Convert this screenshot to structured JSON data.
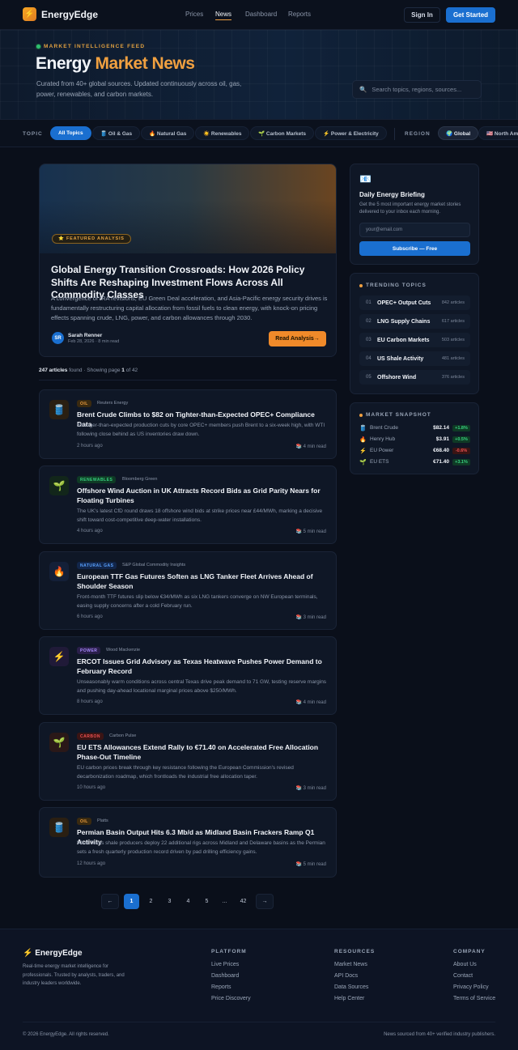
{
  "nav": {
    "brand": "EnergyEdge",
    "links": [
      "Prices",
      "News",
      "Dashboard",
      "Reports"
    ],
    "active_link": "News",
    "sign_in": "Sign In",
    "get_started": "Get Started"
  },
  "hero": {
    "eyebrow": "MARKET INTELLIGENCE FEED",
    "title_a": "Energy ",
    "title_b": "Market News",
    "subtitle": "Curated from 40+ global sources. Updated continuously across oil, gas, power, renewables, and carbon markets.",
    "search_placeholder": "Search topics, regions, sources..."
  },
  "filters": {
    "topic_label": "TOPIC",
    "topics": [
      "All Topics",
      "🛢️ Oil & Gas",
      "🔥 Natural Gas",
      "☀️ Renewables",
      "🌱 Carbon Markets",
      "⚡ Power & Electricity"
    ],
    "region_label": "REGION",
    "regions": [
      "🌍 Global",
      "🇺🇸 North America"
    ]
  },
  "featured": {
    "badge": "⭐ FEATURED ANALYSIS",
    "title": "Global Energy Transition Crossroads: How 2026 Policy Shifts Are Reshaping Investment Flows Across All Commodity Classes",
    "excerpt": "A convergence of IRA revisions, EU Green Deal acceleration, and Asia-Pacific energy security drives is fundamentally restructuring capital allocation from fossil fuels to clean energy, with knock-on pricing effects spanning crude, LNG, power, and carbon allowances through 2030.",
    "author_initials": "SR",
    "author_name": "Sarah Renner",
    "author_meta": "Feb 28, 2026 · 8 min read",
    "cta": "Read Analysis→"
  },
  "results": {
    "count": "247 articles",
    "found": " found · Showing page ",
    "page": "1",
    "of": " of 42"
  },
  "articles": [
    {
      "icon": "🛢️",
      "tag": "OIL",
      "source": "Reuters Energy",
      "title": "Brent Crude Climbs to $82 on Tighter-than-Expected OPEC+ Compliance Data",
      "excerpt": "Stronger-than-expected production cuts by core OPEC+ members push Brent to a six-week high, with WTI following close behind as US inventories draw down.",
      "time": "2 hours ago",
      "read": "📚 4 min read"
    },
    {
      "icon": "🌱",
      "tag": "RENEWABLES",
      "source": "Bloomberg Green",
      "title": "Offshore Wind Auction in UK Attracts Record Bids as Grid Parity Nears for Floating Turbines",
      "excerpt": "The UK's latest CfD round draws 18 offshore wind bids at strike prices near £44/MWh, marking a decisive shift toward cost-competitive deep-water installations.",
      "time": "4 hours ago",
      "read": "📚 5 min read"
    },
    {
      "icon": "🔥",
      "tag": "NATURAL GAS",
      "source": "S&P Global Commodity Insights",
      "title": "European TTF Gas Futures Soften as LNG Tanker Fleet Arrives Ahead of Shoulder Season",
      "excerpt": "Front-month TTF futures slip below €34/MWh as six LNG tankers converge on NW European terminals, easing supply concerns after a cold February run.",
      "time": "6 hours ago",
      "read": "📚 3 min read"
    },
    {
      "icon": "⚡",
      "tag": "POWER",
      "source": "Wood Mackenzie",
      "title": "ERCOT Issues Grid Advisory as Texas Heatwave Pushes Power Demand to February Record",
      "excerpt": "Unseasonably warm conditions across central Texas drive peak demand to 71 GW, testing reserve margins and pushing day-ahead locational marginal prices above $250/MWh.",
      "time": "8 hours ago",
      "read": "📚 4 min read"
    },
    {
      "icon": "🌱",
      "tag": "CARBON",
      "source": "Carbon Pulse",
      "title": "EU ETS Allowances Extend Rally to €71.40 on Accelerated Free Allocation Phase-Out Timeline",
      "excerpt": "EU carbon prices break through key resistance following the European Commission's revised decarbonization roadmap, which frontloads the industrial free allocation taper.",
      "time": "10 hours ago",
      "read": "📚 3 min read"
    },
    {
      "icon": "🛢️",
      "tag": "OIL",
      "source": "Platts",
      "title": "Permian Basin Output Hits 6.3 Mb/d as Midland Basin Frackers Ramp Q1 Activity",
      "excerpt": "West Texas shale producers deploy 22 additional rigs across Midland and Delaware basins as the Permian sets a fresh quarterly production record driven by pad drilling efficiency gains.",
      "time": "12 hours ago",
      "read": "📚 5 min read"
    }
  ],
  "briefing": {
    "icon": "📧",
    "title": "Daily Energy Briefing",
    "desc": "Get the 5 most important energy market stories delivered to your inbox each morning.",
    "placeholder": "your@email.com",
    "button": "Subscribe — Free"
  },
  "trending": {
    "heading": "TRENDING TOPICS",
    "items": [
      {
        "num": "01",
        "name": "OPEC+ Output Cuts",
        "count": "842 articles"
      },
      {
        "num": "02",
        "name": "LNG Supply Chains",
        "count": "617 articles"
      },
      {
        "num": "03",
        "name": "EU Carbon Markets",
        "count": "503 articles"
      },
      {
        "num": "04",
        "name": "US Shale Activity",
        "count": "481 articles"
      },
      {
        "num": "05",
        "name": "Offshore Wind",
        "count": "376 articles"
      }
    ]
  },
  "snapshot": {
    "heading": "MARKET SNAPSHOT",
    "items": [
      {
        "icon": "🛢️",
        "name": "Brent Crude",
        "price": "$82.14",
        "change": "+1.8%",
        "dir": "up"
      },
      {
        "icon": "🔥",
        "name": "Henry Hub",
        "price": "$3.91",
        "change": "+0.5%",
        "dir": "up"
      },
      {
        "icon": "⚡",
        "name": "EU Power",
        "price": "€68.40",
        "change": "-0.6%",
        "dir": "down"
      },
      {
        "icon": "🌱",
        "name": "EU ETS",
        "price": "€71.40",
        "change": "+3.1%",
        "dir": "up"
      }
    ]
  },
  "pagination": [
    "←",
    "1",
    "2",
    "3",
    "4",
    "5",
    "...",
    "42",
    "→"
  ],
  "footer": {
    "brand": "⚡ EnergyEdge",
    "desc": "Real-time energy market intelligence for professionals. Trusted by analysts, traders, and industry leaders worldwide.",
    "cols": [
      {
        "head": "PLATFORM",
        "links": [
          "Live Prices",
          "Dashboard",
          "Reports",
          "Price Discovery"
        ]
      },
      {
        "head": "RESOURCES",
        "links": [
          "Market News",
          "API Docs",
          "Data Sources",
          "Help Center"
        ]
      },
      {
        "head": "COMPANY",
        "links": [
          "About Us",
          "Contact",
          "Privacy Policy",
          "Terms of Service"
        ]
      }
    ],
    "copyright": "© 2026 EnergyEdge. All rights reserved.",
    "note": "News sourced from 40+ verified industry publishers."
  },
  "colors": {
    "accent": "#f0a040",
    "primary": "#1a6fd0",
    "background": "#0a0f1a"
  }
}
